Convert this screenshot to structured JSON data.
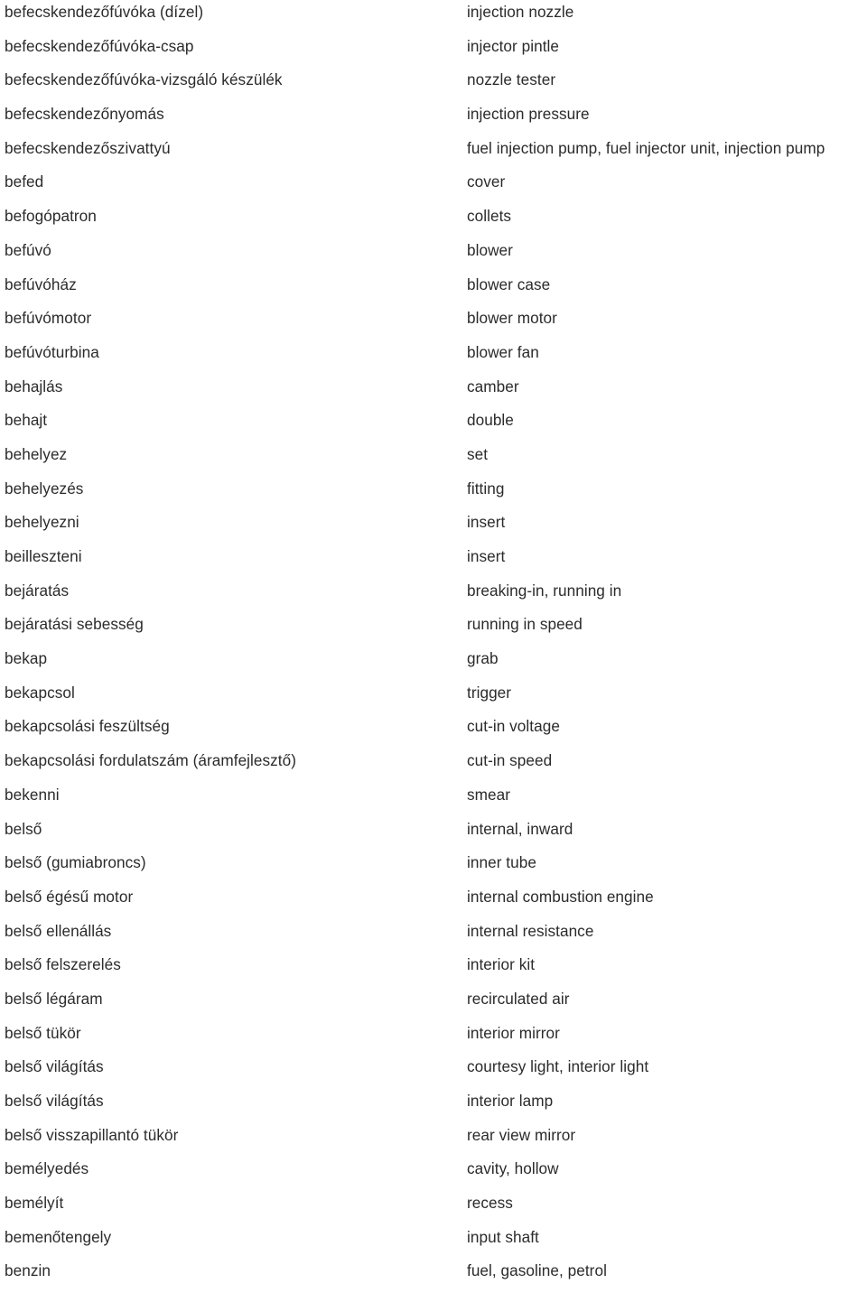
{
  "document": {
    "type": "bilingual-glossary",
    "source_language": "Hungarian",
    "target_language": "English",
    "text_color": "#2b2b2b",
    "background_color": "#ffffff",
    "entries": [
      {
        "source": "befecskendezőfúvóka (dízel)",
        "target": "injection nozzle"
      },
      {
        "source": "befecskendezőfúvóka-csap",
        "target": "injector pintle"
      },
      {
        "source": "befecskendezőfúvóka-vizsgáló készülék",
        "target": "nozzle tester"
      },
      {
        "source": "befecskendezőnyomás",
        "target": "injection pressure"
      },
      {
        "source": "befecskendezőszivattyú",
        "target": "fuel injection pump, fuel injector unit, injection pump"
      },
      {
        "source": "befed",
        "target": "cover"
      },
      {
        "source": "befogópatron",
        "target": "collets"
      },
      {
        "source": "befúvó",
        "target": "blower"
      },
      {
        "source": "befúvóház",
        "target": "blower case"
      },
      {
        "source": "befúvómotor",
        "target": "blower motor"
      },
      {
        "source": "befúvóturbina",
        "target": "blower fan"
      },
      {
        "source": "behajlás",
        "target": "camber"
      },
      {
        "source": "behajt",
        "target": "double"
      },
      {
        "source": "behelyez",
        "target": "set"
      },
      {
        "source": "behelyezés",
        "target": "fitting"
      },
      {
        "source": "behelyezni",
        "target": "insert"
      },
      {
        "source": "beilleszteni",
        "target": "insert"
      },
      {
        "source": "bejáratás",
        "target": "breaking-in, running in"
      },
      {
        "source": "bejáratási sebesség",
        "target": "running in speed"
      },
      {
        "source": "bekap",
        "target": "grab"
      },
      {
        "source": "bekapcsol",
        "target": "trigger"
      },
      {
        "source": "bekapcsolási feszültség",
        "target": "cut-in voltage"
      },
      {
        "source": "bekapcsolási fordulatszám (áramfejlesztő)",
        "target": "cut-in speed"
      },
      {
        "source": "bekenni",
        "target": "smear"
      },
      {
        "source": "belső",
        "target": "internal, inward"
      },
      {
        "source": "belső (gumiabroncs)",
        "target": "inner tube"
      },
      {
        "source": "belső égésű motor",
        "target": "internal combustion engine"
      },
      {
        "source": "belső ellenállás",
        "target": "internal resistance"
      },
      {
        "source": "belső felszerelés",
        "target": "interior kit"
      },
      {
        "source": "belső légáram",
        "target": "recirculated air"
      },
      {
        "source": "belső tükör",
        "target": "interior mirror"
      },
      {
        "source": "belső világítás",
        "target": "courtesy light, interior light"
      },
      {
        "source": "belső világítás",
        "target": "interior lamp"
      },
      {
        "source": "belső visszapillantó tükör",
        "target": "rear view mirror"
      },
      {
        "source": "bemélyedés",
        "target": "cavity, hollow"
      },
      {
        "source": "bemélyít",
        "target": "recess"
      },
      {
        "source": "bemenőtengely",
        "target": "input shaft"
      },
      {
        "source": "benzin",
        "target": "fuel, gasoline, petrol"
      }
    ]
  }
}
